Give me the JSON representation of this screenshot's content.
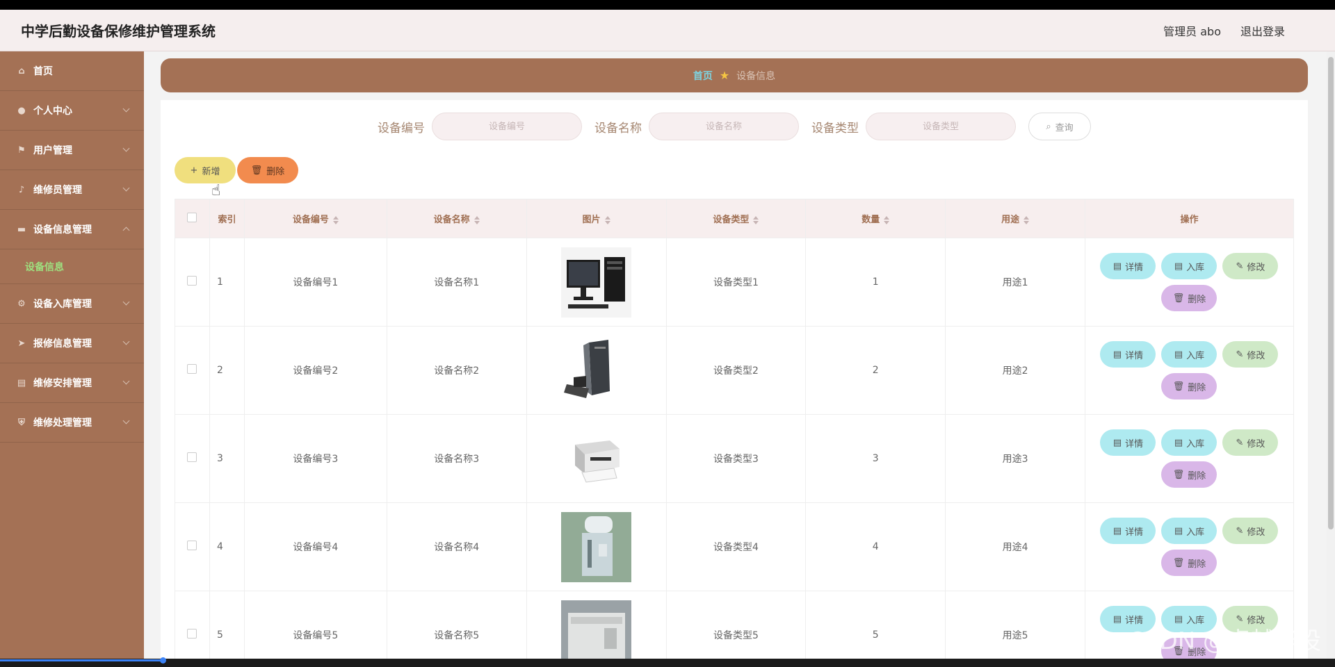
{
  "header": {
    "title": "中学后勤设备保修维护管理系统",
    "admin_label": "管理员 abo",
    "logout_label": "退出登录"
  },
  "sidebar": {
    "items": [
      {
        "label": "首页",
        "icon": "home-icon"
      },
      {
        "label": "个人中心",
        "icon": "user-icon"
      },
      {
        "label": "用户管理",
        "icon": "flag-icon"
      },
      {
        "label": "维修员管理",
        "icon": "mic-icon"
      },
      {
        "label": "设备信息管理",
        "icon": "card-icon",
        "expanded": true
      },
      {
        "label": "设备入库管理",
        "icon": "gear-icon"
      },
      {
        "label": "报修信息管理",
        "icon": "send-icon"
      },
      {
        "label": "维修安排管理",
        "icon": "list-icon"
      },
      {
        "label": "维修处理管理",
        "icon": "shield-icon"
      }
    ],
    "sub_item": "设备信息"
  },
  "breadcrumb": {
    "home": "首页",
    "current": "设备信息"
  },
  "search": {
    "fields": [
      {
        "label": "设备编号",
        "placeholder": "设备编号"
      },
      {
        "label": "设备名称",
        "placeholder": "设备名称"
      },
      {
        "label": "设备类型",
        "placeholder": "设备类型"
      }
    ],
    "button": "查询"
  },
  "actions": {
    "add": "新增",
    "delete": "删除"
  },
  "table": {
    "headers": [
      "索引",
      "设备编号",
      "设备名称",
      "图片",
      "设备类型",
      "数量",
      "用途",
      "操作"
    ],
    "rows": [
      {
        "index": "1",
        "code": "设备编号1",
        "name": "设备名称1",
        "type": "设备类型1",
        "qty": "1",
        "use": "用途1"
      },
      {
        "index": "2",
        "code": "设备编号2",
        "name": "设备名称2",
        "type": "设备类型2",
        "qty": "2",
        "use": "用途2"
      },
      {
        "index": "3",
        "code": "设备编号3",
        "name": "设备名称3",
        "type": "设备类型3",
        "qty": "3",
        "use": "用途3"
      },
      {
        "index": "4",
        "code": "设备编号4",
        "name": "设备名称4",
        "type": "设备类型4",
        "qty": "4",
        "use": "用途4"
      },
      {
        "index": "5",
        "code": "设备编号5",
        "name": "设备名称5",
        "type": "设备类型5",
        "qty": "5",
        "use": "用途5"
      }
    ],
    "row_buttons": {
      "detail": "详情",
      "stock_in": "入库",
      "edit": "修改",
      "delete": "删除"
    }
  },
  "watermark": "CSDN @卓越毕设",
  "colors": {
    "sidebar": "#a47155",
    "accent_green": "#9ee07f",
    "breadcrumb_home": "#7dd3e0"
  }
}
